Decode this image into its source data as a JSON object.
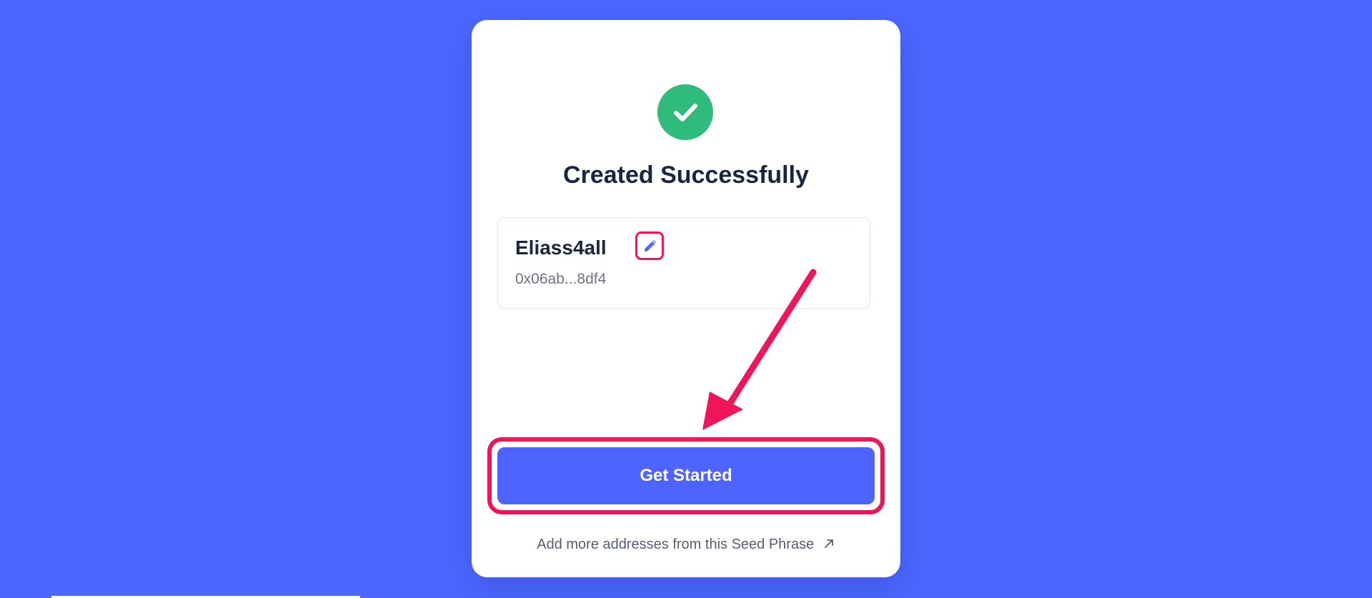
{
  "status": {
    "title": "Created Successfully",
    "icon": "check-icon",
    "icon_color": "#2ebb7b"
  },
  "account": {
    "name": "Eliass4all",
    "address": "0x06ab...8df4",
    "edit_icon": "pencil-icon"
  },
  "actions": {
    "primary_label": "Get Started",
    "secondary_label": "Add more addresses from this Seed Phrase",
    "secondary_icon": "external-link-arrow-icon"
  },
  "colors": {
    "background": "#4c67ff",
    "primary_button": "#4f63ff",
    "annotation": "#f0145a"
  }
}
